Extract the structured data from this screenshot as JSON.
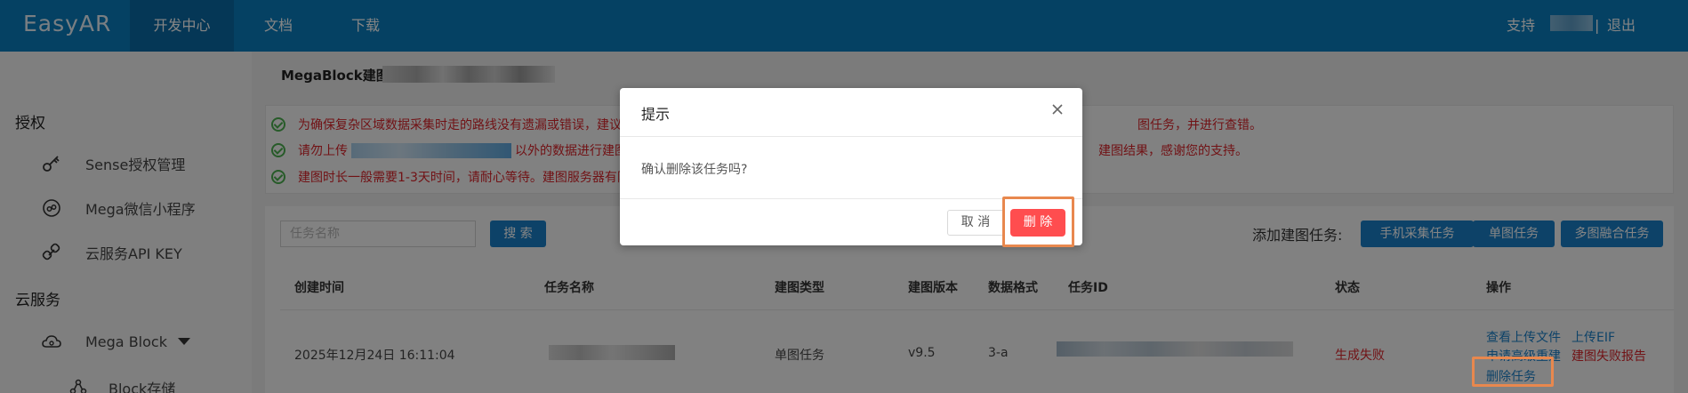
{
  "header": {
    "logo": "EasyAR",
    "nav": [
      {
        "label": "开发中心",
        "active": true
      },
      {
        "label": "文档",
        "active": false
      },
      {
        "label": "下载",
        "active": false
      }
    ],
    "support": "支持",
    "separator": "|",
    "logout": "退出",
    "colors": {
      "bar": "#0b7ebf",
      "active_tab": "#0a6aa5"
    }
  },
  "sidebar": {
    "section_auth": "授权",
    "auth_items": [
      {
        "label": "Sense授权管理",
        "icon": "key-icon"
      },
      {
        "label": "Mega微信小程序",
        "icon": "miniprogram-icon"
      },
      {
        "label": "云服务API KEY",
        "icon": "link-key-icon"
      }
    ],
    "section_cloud": "云服务",
    "cloud_items": [
      {
        "label": "Mega Block",
        "icon": "cloud-icon",
        "expanded": true
      },
      {
        "label": "Block存储",
        "icon": "nodes-icon"
      }
    ]
  },
  "breadcrumb": {
    "root": "MegaBlock建图 >"
  },
  "notices": [
    {
      "before": "为确保复杂区域数据采集时走的路线没有遗漏或错误，建议",
      "after": "图任务，并进行查错。"
    },
    {
      "before": "请勿上传",
      "middle": "以外的数据进行建图",
      "after": "建图结果，感谢您的支持。"
    },
    {
      "before": "建图时长一般需要1-3天时间，请耐心等待。建图服务器有限",
      "after": ""
    }
  ],
  "toolbar": {
    "search_placeholder": "任务名称",
    "search_button": "搜 索",
    "add_label": "添加建图任务:",
    "add_buttons": [
      "手机采集任务",
      "单图任务",
      "多图融合任务"
    ]
  },
  "table": {
    "columns": [
      "创建时间",
      "任务名称",
      "建图类型",
      "建图版本",
      "数据格式",
      "任务ID",
      "状态",
      "操作"
    ],
    "rows": [
      {
        "created": "2025年12月24日 16:11:04",
        "type": "单图任务",
        "version": "v9.5",
        "format": "3-a",
        "status": "生成失败",
        "actions": [
          "查看上传文件",
          "上传EIF",
          "申请高级重建",
          "建图失败报告",
          "删除任务"
        ]
      }
    ]
  },
  "modal": {
    "title": "提示",
    "body": "确认删除该任务吗?",
    "cancel": "取 消",
    "confirm": "删 除",
    "colors": {
      "confirm": "#ff4d4f",
      "highlight": "#e8884e"
    }
  }
}
